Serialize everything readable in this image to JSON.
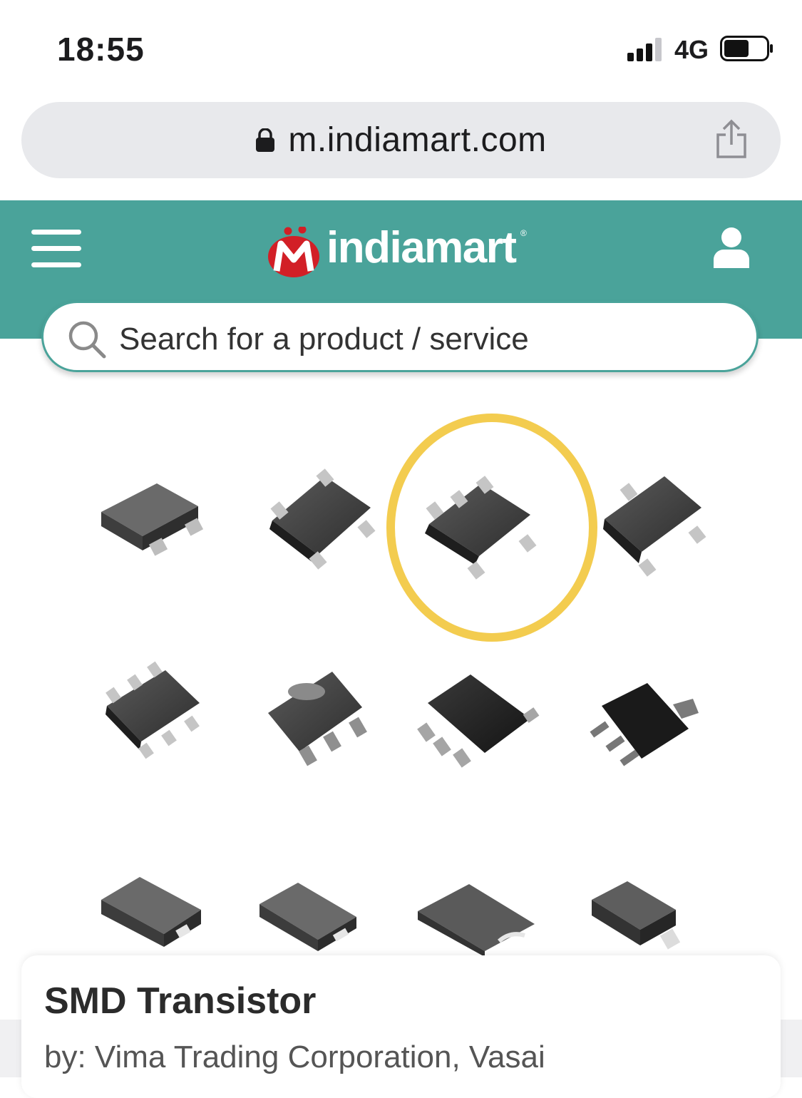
{
  "status_bar": {
    "time": "18:55",
    "network": "4G"
  },
  "browser": {
    "url": "m.indiamart.com"
  },
  "header": {
    "logo_text": "indiamart",
    "logo_letter": "M",
    "logo_reg": "®",
    "bg_color": "#4aa39a"
  },
  "search": {
    "placeholder": "Search for a product / service"
  },
  "product": {
    "title": "SMD Transistor",
    "seller": "by: Vima Trading Corporation, Vasai"
  },
  "colors": {
    "highlight_circle": "#f3cc4f"
  }
}
